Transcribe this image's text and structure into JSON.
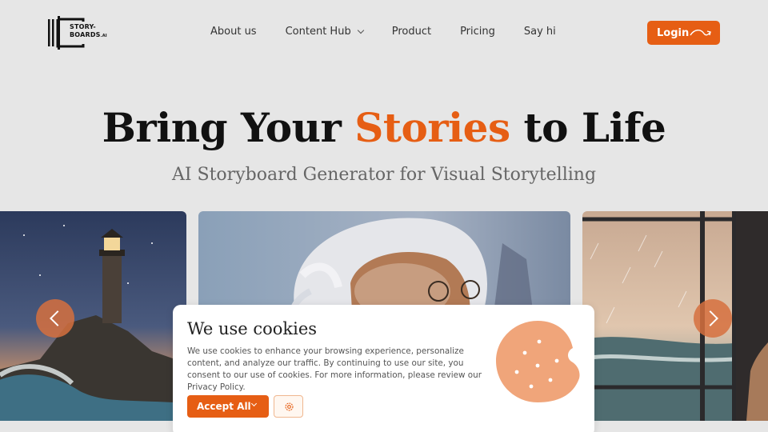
{
  "brand": {
    "line1": "STORY-",
    "line2": "BOARDS",
    "suffix": ".AI",
    "accent_color": "#e65e14"
  },
  "nav": {
    "items": [
      "About us",
      "Content Hub",
      "Product",
      "Pricing",
      "Say hi"
    ]
  },
  "header": {
    "login_label": "Login"
  },
  "hero": {
    "title_part1": "Bring Your ",
    "title_accent": "Stories",
    "title_part2": " to Life",
    "subtitle": "AI Storyboard Generator for Visual Storytelling"
  },
  "carousel": {
    "slides": [
      "lighthouse-at-night",
      "elderly-man-portrait",
      "rainy-sea-window"
    ],
    "prev_icon": "chevron-left-icon",
    "next_icon": "chevron-right-icon"
  },
  "cookie": {
    "title": "We use cookies",
    "text": "We use cookies to enhance your browsing experience, personalize content, and analyze our traffic. By continuing to use our site, you consent to our use of cookies. For more information, please review our Privacy Policy.",
    "accept_label": "Accept All",
    "settings_icon": "gear-icon",
    "image": "cookie-icon"
  }
}
